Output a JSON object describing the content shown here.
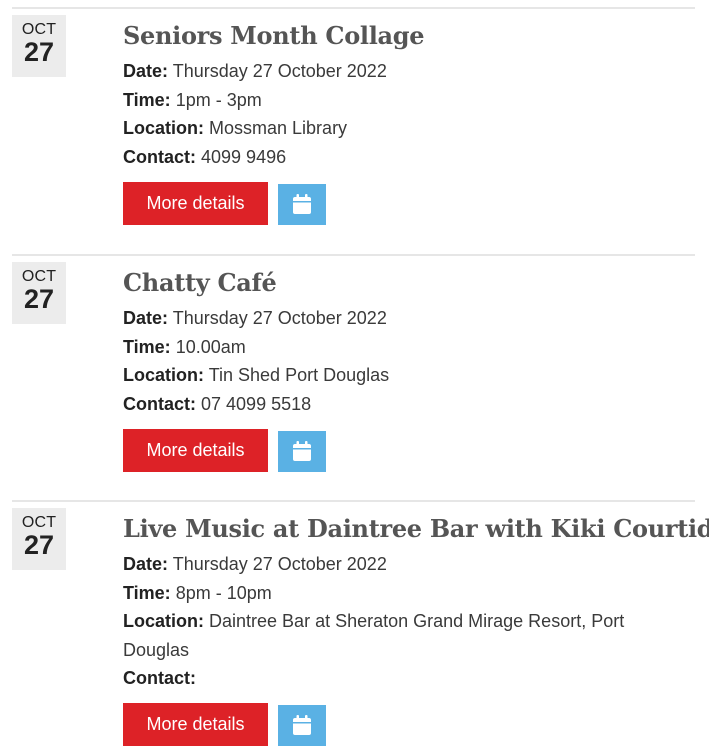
{
  "events": [
    {
      "month": "OCT",
      "day": "27",
      "title": "Seniors Month Collage",
      "date_label": "Date:",
      "date": "Thursday 27 October 2022",
      "time_label": "Time:",
      "time": "1pm - 3pm",
      "location_label": "Location:",
      "location": "Mossman Library",
      "contact_label": "Contact:",
      "contact": "4099 9496",
      "button_label": "More details",
      "calendar_icon": "calendar-icon"
    },
    {
      "month": "OCT",
      "day": "27",
      "title": "Chatty Café",
      "date_label": "Date:",
      "date": "Thursday 27 October 2022",
      "time_label": "Time:",
      "time": "10.00am",
      "location_label": "Location:",
      "location": "Tin Shed Port Douglas",
      "contact_label": "Contact:",
      "contact": "07 4099 5518",
      "button_label": "More details",
      "calendar_icon": "calendar-icon"
    },
    {
      "month": "OCT",
      "day": "27",
      "title": "Live Music at Daintree Bar with Kiki Courtidis",
      "date_label": "Date:",
      "date": "Thursday 27 October 2022",
      "time_label": "Time:",
      "time": "8pm - 10pm",
      "location_label": "Location:",
      "location": "Daintree Bar at Sheraton Grand Mirage Resort, Port Douglas",
      "contact_label": "Contact:",
      "contact": "",
      "button_label": "More details",
      "calendar_icon": "calendar-icon"
    }
  ],
  "colors": {
    "more_button": "#dd2227",
    "calendar_button": "#5ab1e4",
    "date_badge": "#ececec",
    "title": "#555555"
  }
}
